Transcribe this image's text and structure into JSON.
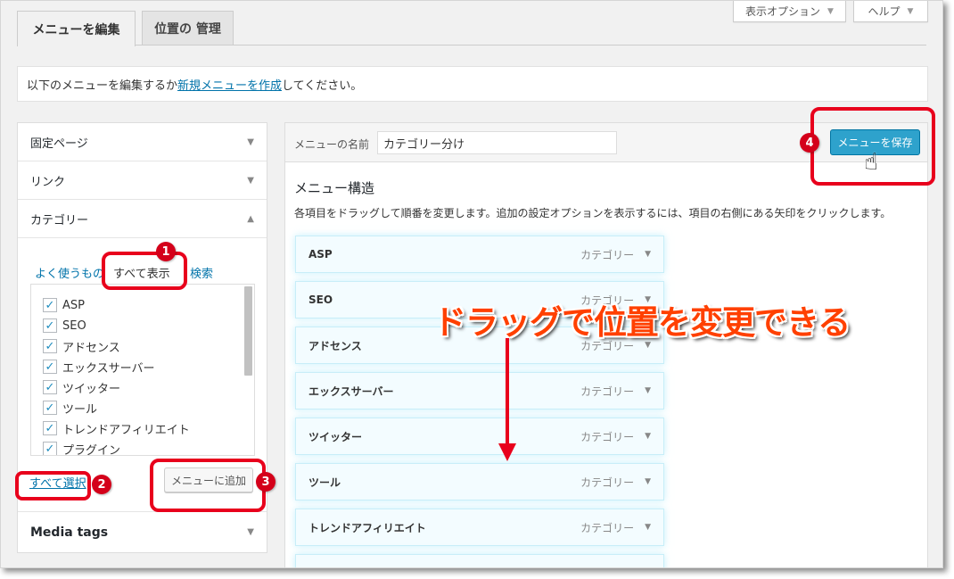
{
  "tabs": {
    "edit": "メニューを編集",
    "locations": "位置の 管理"
  },
  "screen_options": "表示オプション",
  "help": "ヘルプ",
  "notice": {
    "before": "以下のメニューを編集するか",
    "link": "新規メニューを作成",
    "after": "してください。"
  },
  "sidebar": {
    "sections": {
      "pages": "固定ページ",
      "links": "リンク",
      "categories": "カテゴリー",
      "media_tags": "Media tags"
    },
    "cat_tabs": {
      "most_used": "よく使うもの",
      "view_all": "すべて表示",
      "search": "検索"
    },
    "categories": [
      "ASP",
      "SEO",
      "アドセンス",
      "エックスサーバー",
      "ツイッター",
      "ツール",
      "トレンドアフィリエイト",
      "プラグイン"
    ],
    "select_all": "すべて選択",
    "add_to_menu": "メニューに追加"
  },
  "menu": {
    "name_label": "メニューの名前",
    "name_value": "カテゴリー分け",
    "save": "メニューを保存",
    "structure_title": "メニュー構造",
    "structure_desc": "各項目をドラッグして順番を変更します。追加の設定オプションを表示するには、項目の右側にある矢印をクリックします。",
    "item_type": "カテゴリー",
    "items": [
      "ASP",
      "SEO",
      "アドセンス",
      "エックスサーバー",
      "ツイッター",
      "ツール",
      "トレンドアフィリエイト"
    ]
  },
  "annotation": {
    "caption": "ドラッグで位置を変更できる",
    "badges": [
      "1",
      "2",
      "3",
      "4"
    ],
    "colors": {
      "red": "#e8001c",
      "caption": "#ff4000",
      "save_button": "#2ea2cc"
    }
  }
}
